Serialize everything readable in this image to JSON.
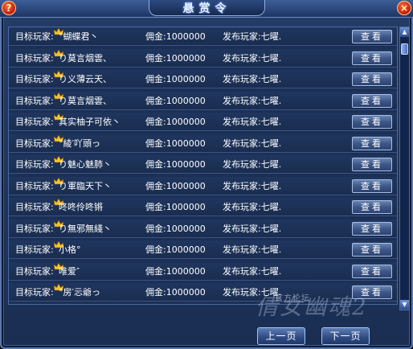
{
  "window": {
    "title": "悬赏令",
    "help_label": "?",
    "close_label": "×"
  },
  "rows": [
    {
      "target_label": "目标玩家:",
      "target_name": "°蝴蝶君丶",
      "reward": "佣金:1000000",
      "publisher": "发布玩家:七曜.",
      "view_label": "查看"
    },
    {
      "target_label": "目标玩家:",
      "target_name": "り莫言烟雲、",
      "reward": "佣金:1000000",
      "publisher": "发布玩家:七曜.",
      "view_label": "查看"
    },
    {
      "target_label": "目标玩家:",
      "target_name": "り义薄云天、",
      "reward": "佣金:1000000",
      "publisher": "发布玩家:七曜.",
      "view_label": "查看"
    },
    {
      "target_label": "目标玩家:",
      "target_name": "り莫言烟雲、",
      "reward": "佣金:1000000",
      "publisher": "发布玩家:七曜.",
      "view_label": "查看"
    },
    {
      "target_label": "目标玩家:",
      "target_name": "其实柚子可依丶",
      "reward": "佣金:1000000",
      "publisher": "发布玩家:七曜.",
      "view_label": "查看"
    },
    {
      "target_label": "目标玩家:",
      "target_name": "°綾′吖頭っ",
      "reward": "佣金:1000000",
      "publisher": "发布玩家:七曜.",
      "view_label": "查看"
    },
    {
      "target_label": "目标玩家:",
      "target_name": "り魅心魅肺丶",
      "reward": "佣金:1000000",
      "publisher": "发布玩家:七曜.",
      "view_label": "查看"
    },
    {
      "target_label": "目标玩家:",
      "target_name": "り軍臨天下丶",
      "reward": "佣金:1000000",
      "publisher": "发布玩家:七曜.",
      "view_label": "查看"
    },
    {
      "target_label": "目标玩家:",
      "target_name": "咚咚伶咚锵",
      "reward": "佣金:1000000",
      "publisher": "发布玩家:七曜.",
      "view_label": "查看"
    },
    {
      "target_label": "目标玩家:",
      "target_name": "り無邪無綫丶",
      "reward": "佣金:1000000",
      "publisher": "发布玩家:七曜.",
      "view_label": "查看"
    },
    {
      "target_label": "目标玩家:",
      "target_name": "小格°",
      "reward": "佣金:1000000",
      "publisher": "发布玩家:七曜.",
      "view_label": "查看"
    },
    {
      "target_label": "目标玩家:",
      "target_name": "唯爱″",
      "reward": "佣金:1000000",
      "publisher": "发布玩家:七曜.",
      "view_label": "查看"
    },
    {
      "target_label": "目标玩家:",
      "target_name": "°房′忈爺っ",
      "reward": "佣金:1000000",
      "publisher": "发布玩家:七曜.",
      "view_label": "查看"
    }
  ],
  "pagination": {
    "prev_label": "上一页",
    "next_label": "下一页"
  },
  "watermark": {
    "forum_text": "官方论坛",
    "logo_text": "倩女幽魂2"
  },
  "icons": {
    "row_icon": "crown-icon",
    "scroll_up": "scroll-up-arrow-icon",
    "scroll_down": "scroll-down-arrow-icon"
  },
  "colors": {
    "panel_bg": "#1c2f55",
    "crown": "#f2c230",
    "button": "#3e5788"
  }
}
